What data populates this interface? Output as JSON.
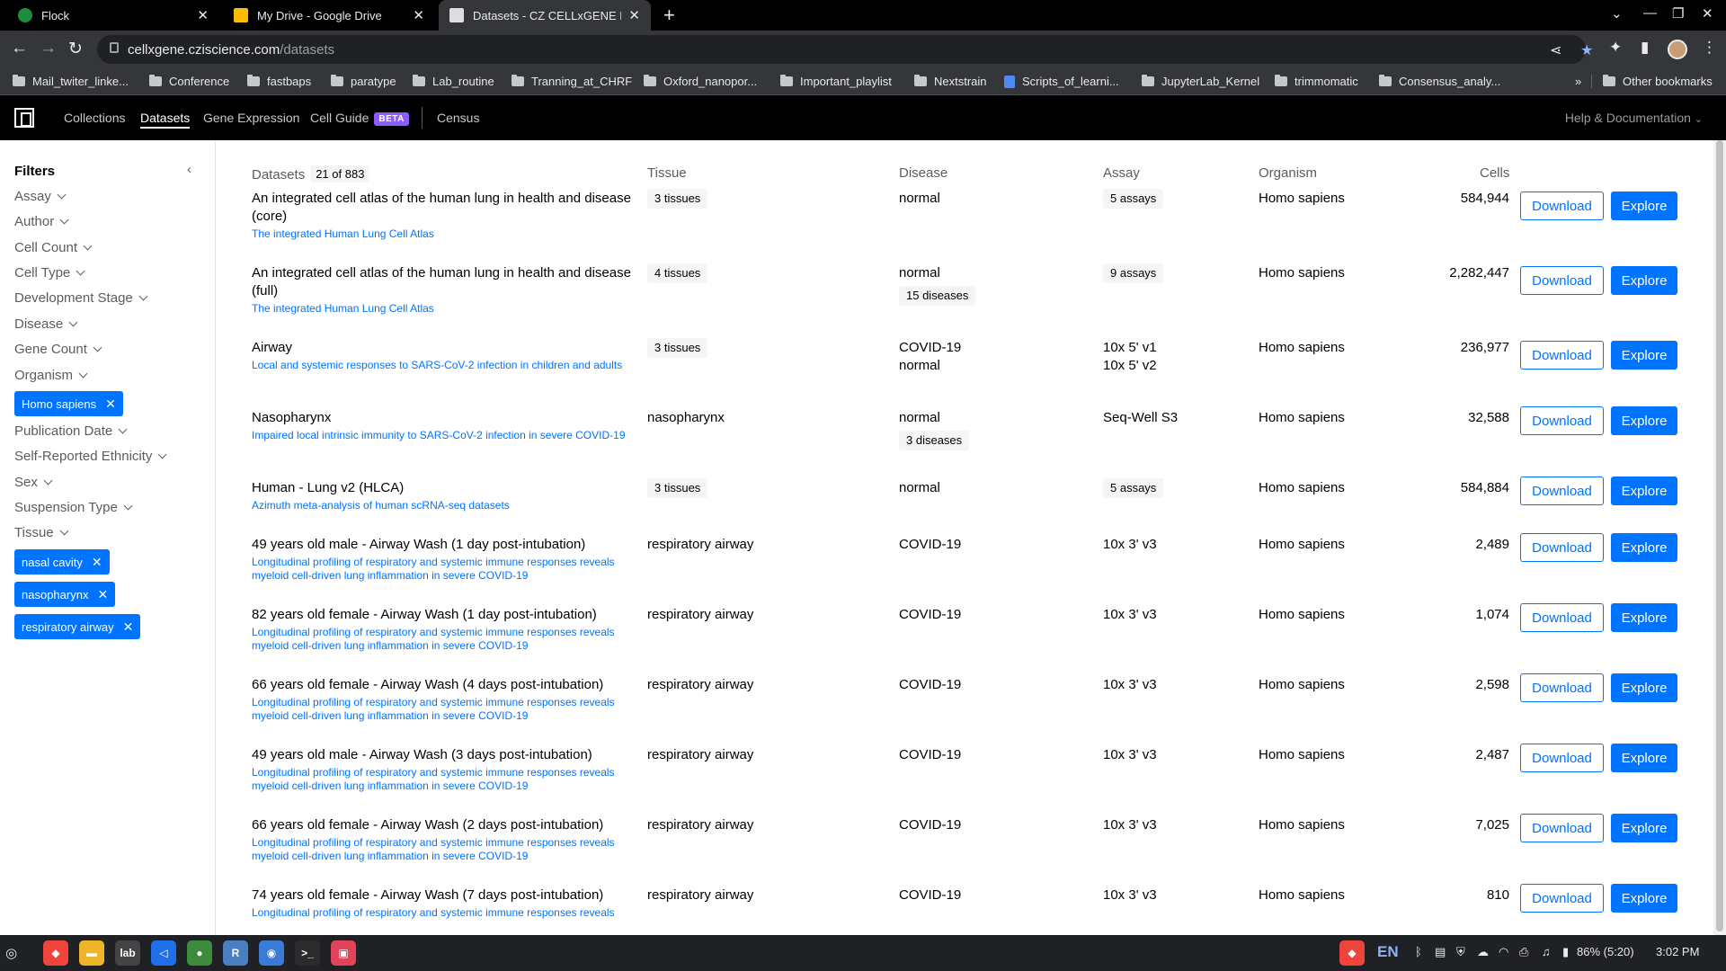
{
  "browser": {
    "tabs": [
      {
        "title": "Flock",
        "color": "#1e8e3e"
      },
      {
        "title": "My Drive - Google Drive",
        "color": "#fbbc04"
      },
      {
        "title": "Datasets - CZ CELLxGENE Disc",
        "color": "#dddddd"
      }
    ],
    "url_host": "cellxgene.cziscience.com",
    "url_path": "/datasets",
    "bookmarks": [
      {
        "label": "Mail_twiter_linke...",
        "icon": "folder"
      },
      {
        "label": "Conference",
        "icon": "folder"
      },
      {
        "label": "fastbaps",
        "icon": "folder"
      },
      {
        "label": "paratype",
        "icon": "folder"
      },
      {
        "label": "Lab_routine",
        "icon": "folder"
      },
      {
        "label": "Tranning_at_CHRF",
        "icon": "folder"
      },
      {
        "label": "Oxford_nanopor...",
        "icon": "folder"
      },
      {
        "label": "Important_playlist",
        "icon": "folder"
      },
      {
        "label": "Nextstrain",
        "icon": "folder"
      },
      {
        "label": "Scripts_of_learni...",
        "icon": "doc"
      },
      {
        "label": "JupyterLab_Kernel",
        "icon": "folder"
      },
      {
        "label": "trimmomatic",
        "icon": "folder"
      },
      {
        "label": "Consensus_analy...",
        "icon": "folder"
      }
    ],
    "other_bookmarks": "Other bookmarks"
  },
  "nav": {
    "links": [
      "Collections",
      "Datasets",
      "Gene Expression",
      "Cell Guide"
    ],
    "beta": "BETA",
    "census": "Census",
    "help": "Help & Documentation"
  },
  "filters": {
    "title": "Filters",
    "items": [
      "Assay",
      "Author",
      "Cell Count",
      "Cell Type",
      "Development Stage",
      "Disease",
      "Gene Count",
      "Organism",
      "Publication Date",
      "Self-Reported Ethnicity",
      "Sex",
      "Suspension Type",
      "Tissue"
    ],
    "organism_chips": [
      "Homo sapiens"
    ],
    "tissue_chips": [
      "nasal cavity",
      "nasopharynx",
      "respiratory airway"
    ]
  },
  "table": {
    "headers": {
      "datasets": "Datasets",
      "count": "21 of 883",
      "tissue": "Tissue",
      "disease": "Disease",
      "assay": "Assay",
      "organism": "Organism",
      "cells": "Cells"
    },
    "download_label": "Download",
    "explore_label": "Explore",
    "rows": [
      {
        "title": "An integrated cell atlas of the human lung in health and disease (core)",
        "collection": "The integrated Human Lung Cell Atlas",
        "tissue": "3 tissues",
        "tissue_tag": true,
        "disease": [
          "normal"
        ],
        "disease_tag": "",
        "assay": [
          "5 assays"
        ],
        "assay_tag": true,
        "organism": "Homo sapiens",
        "cells": "584,944"
      },
      {
        "title": "An integrated cell atlas of the human lung in health and disease (full)",
        "collection": "The integrated Human Lung Cell Atlas",
        "tissue": "4 tissues",
        "tissue_tag": true,
        "disease": [
          "normal"
        ],
        "disease_tag": "15 diseases",
        "assay": [
          "9 assays"
        ],
        "assay_tag": true,
        "organism": "Homo sapiens",
        "cells": "2,282,447"
      },
      {
        "title": "Airway",
        "collection": "Local and systemic responses to SARS-CoV-2 infection in children and adults",
        "tissue": "3 tissues",
        "tissue_tag": true,
        "disease": [
          "COVID-19",
          "normal"
        ],
        "disease_tag": "",
        "assay": [
          "10x 5' v1",
          "10x 5' v2"
        ],
        "assay_tag": false,
        "organism": "Homo sapiens",
        "cells": "236,977"
      },
      {
        "title": "Nasopharynx",
        "collection": "Impaired local intrinsic immunity to SARS-CoV-2 infection in severe COVID-19",
        "tissue": "nasopharynx",
        "tissue_tag": false,
        "disease": [
          "normal"
        ],
        "disease_tag": "3 diseases",
        "assay": [
          "Seq-Well S3"
        ],
        "assay_tag": false,
        "organism": "Homo sapiens",
        "cells": "32,588"
      },
      {
        "title": "Human - Lung v2 (HLCA)",
        "collection": "Azimuth meta-analysis of human scRNA-seq datasets",
        "tissue": "3 tissues",
        "tissue_tag": true,
        "disease": [
          "normal"
        ],
        "disease_tag": "",
        "assay": [
          "5 assays"
        ],
        "assay_tag": true,
        "organism": "Homo sapiens",
        "cells": "584,884"
      },
      {
        "title": "49 years old male - Airway Wash (1 day post-intubation)",
        "collection": "Longitudinal profiling of respiratory and systemic immune responses reveals myeloid cell-driven lung inflammation in severe COVID-19",
        "tissue": "respiratory airway",
        "tissue_tag": false,
        "disease": [
          "COVID-19"
        ],
        "disease_tag": "",
        "assay": [
          "10x 3' v3"
        ],
        "assay_tag": false,
        "organism": "Homo sapiens",
        "cells": "2,489"
      },
      {
        "title": "82 years old female - Airway Wash (1 day post-intubation)",
        "collection": "Longitudinal profiling of respiratory and systemic immune responses reveals myeloid cell-driven lung inflammation in severe COVID-19",
        "tissue": "respiratory airway",
        "tissue_tag": false,
        "disease": [
          "COVID-19"
        ],
        "disease_tag": "",
        "assay": [
          "10x 3' v3"
        ],
        "assay_tag": false,
        "organism": "Homo sapiens",
        "cells": "1,074"
      },
      {
        "title": "66 years old female - Airway Wash (4 days post-intubation)",
        "collection": "Longitudinal profiling of respiratory and systemic immune responses reveals myeloid cell-driven lung inflammation in severe COVID-19",
        "tissue": "respiratory airway",
        "tissue_tag": false,
        "disease": [
          "COVID-19"
        ],
        "disease_tag": "",
        "assay": [
          "10x 3' v3"
        ],
        "assay_tag": false,
        "organism": "Homo sapiens",
        "cells": "2,598"
      },
      {
        "title": "49 years old male - Airway Wash (3 days post-intubation)",
        "collection": "Longitudinal profiling of respiratory and systemic immune responses reveals myeloid cell-driven lung inflammation in severe COVID-19",
        "tissue": "respiratory airway",
        "tissue_tag": false,
        "disease": [
          "COVID-19"
        ],
        "disease_tag": "",
        "assay": [
          "10x 3' v3"
        ],
        "assay_tag": false,
        "organism": "Homo sapiens",
        "cells": "2,487"
      },
      {
        "title": "66 years old female - Airway Wash (2 days post-intubation)",
        "collection": "Longitudinal profiling of respiratory and systemic immune responses reveals myeloid cell-driven lung inflammation in severe COVID-19",
        "tissue": "respiratory airway",
        "tissue_tag": false,
        "disease": [
          "COVID-19"
        ],
        "disease_tag": "",
        "assay": [
          "10x 3' v3"
        ],
        "assay_tag": false,
        "organism": "Homo sapiens",
        "cells": "7,025"
      },
      {
        "title": "74 years old female - Airway Wash (7 days post-intubation)",
        "collection": "Longitudinal profiling of respiratory and systemic immune responses reveals",
        "tissue": "respiratory airway",
        "tissue_tag": false,
        "disease": [
          "COVID-19"
        ],
        "disease_tag": "",
        "assay": [
          "10x 3' v3"
        ],
        "assay_tag": false,
        "organism": "Homo sapiens",
        "cells": "810"
      }
    ]
  },
  "taskbar": {
    "apps": [
      {
        "name": "anydesk-icon",
        "color": "#ef443b",
        "label": "◆"
      },
      {
        "name": "files-icon",
        "color": "#f0b429",
        "label": "▬"
      },
      {
        "name": "jupyterlab-icon",
        "color": "#444444",
        "label": "lab"
      },
      {
        "name": "vscode-icon",
        "color": "#1f6feb",
        "label": "◁"
      },
      {
        "name": "chrome-icon",
        "color": "#3c8c3c",
        "label": "●"
      },
      {
        "name": "rstudio-icon",
        "color": "#4a7ec2",
        "label": "R"
      },
      {
        "name": "screenshot-icon",
        "color": "#3a7bd5",
        "label": "◉"
      },
      {
        "name": "terminal-icon",
        "color": "#2b2b2b",
        "label": ">_"
      },
      {
        "name": "recorder-icon",
        "color": "#e0445a",
        "label": "▣"
      }
    ],
    "lang": "EN",
    "battery": "86% (5:20)",
    "time": "3:02 PM"
  }
}
